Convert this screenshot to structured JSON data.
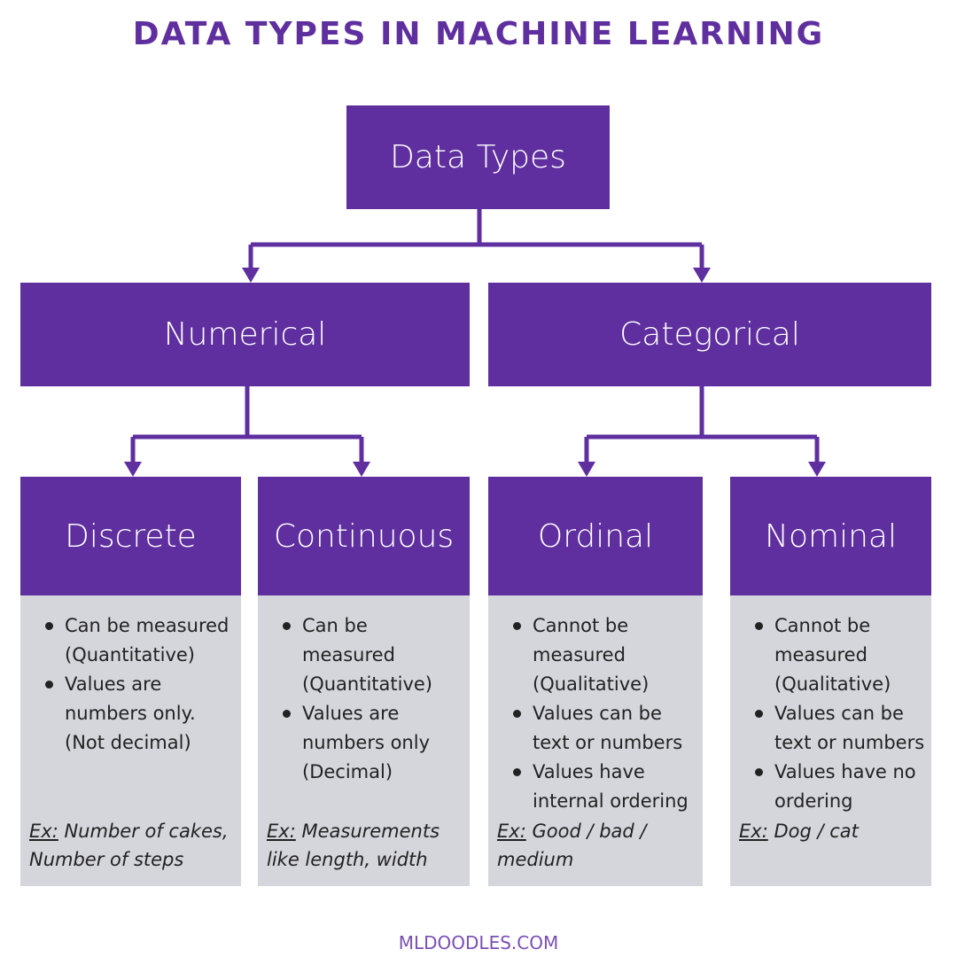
{
  "title": "DATA TYPES IN MACHINE LEARNING",
  "colors": {
    "node": "#5f2f9f",
    "panel": "#d5d5dc",
    "text": "#222222"
  },
  "nodes": {
    "root": "Data Types",
    "numerical": "Numerical",
    "categorical": "Categorical"
  },
  "leaves": [
    {
      "label": "Discrete",
      "bullets": [
        "Can be measured (Quantitative)",
        "Values are numbers only. (Not decimal)"
      ],
      "ex_label": "Ex:",
      "ex_text": "Number of cakes, Number of steps"
    },
    {
      "label": "Continuous",
      "bullets": [
        "Can be measured (Quantitative)",
        "Values are numbers only (Decimal)"
      ],
      "ex_label": "Ex:",
      "ex_text": "Measurements like length, width"
    },
    {
      "label": "Ordinal",
      "bullets": [
        "Cannot be measured (Qualitative)",
        "Values can be text or numbers",
        "Values have internal ordering"
      ],
      "ex_label": "Ex:",
      "ex_text": "Good / bad / medium"
    },
    {
      "label": "Nominal",
      "bullets": [
        "Cannot be measured (Qualitative)",
        "Values can be text or numbers",
        "Values have no ordering"
      ],
      "ex_label": "Ex:",
      "ex_text": "Dog / cat"
    }
  ],
  "footer": "MLDOODLES.COM"
}
